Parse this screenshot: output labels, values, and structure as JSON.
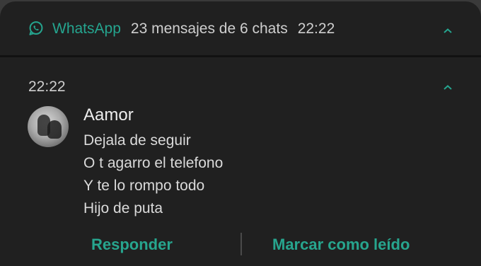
{
  "notification": {
    "app_name": "WhatsApp",
    "summary": "23 mensajes de 6 chats",
    "time": "22:22",
    "accent_color": "#25a58f",
    "icon": "whatsapp-icon"
  },
  "message": {
    "time": "22:22",
    "sender": "Aamor",
    "lines": [
      "Dejala de seguir",
      "O t agarro el telefono",
      "Y te lo rompo todo",
      "Hijo de puta"
    ]
  },
  "actions": {
    "reply_label": "Responder",
    "mark_read_label": "Marcar como leído"
  }
}
